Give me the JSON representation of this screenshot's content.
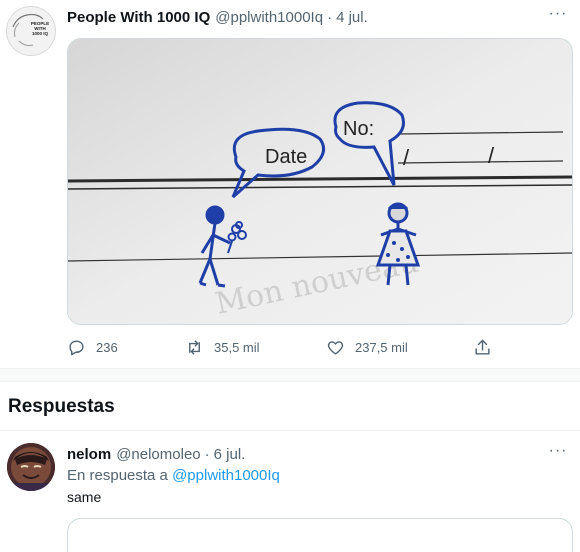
{
  "tweet": {
    "author_name": "People With 1000 IQ",
    "author_handle": "@pplwith1000Iq",
    "separator": "·",
    "date": "4 jul.",
    "more": "···",
    "avatar_text": [
      "PEOPLE",
      "WITH",
      "1000 IQ"
    ],
    "image": {
      "date_label": "Date",
      "no_label": "No:",
      "slash": "/",
      "faded_text": "Mon nouveau"
    },
    "stats": {
      "replies": "236",
      "retweets": "35,5 mil",
      "likes": "237,5 mil"
    }
  },
  "replies_section": {
    "title": "Respuestas"
  },
  "reply": {
    "author_name": "nelom",
    "author_handle": "@nelomoleo",
    "separator": "·",
    "date": "6 jul.",
    "more": "···",
    "reply_to_prefix": "En respuesta a",
    "reply_to_handle": "@pplwith1000Iq",
    "text": "same"
  },
  "colors": {
    "accent": "#1d9bf0",
    "secondary_text": "#536471",
    "ink_blue": "#1f3fa8"
  }
}
